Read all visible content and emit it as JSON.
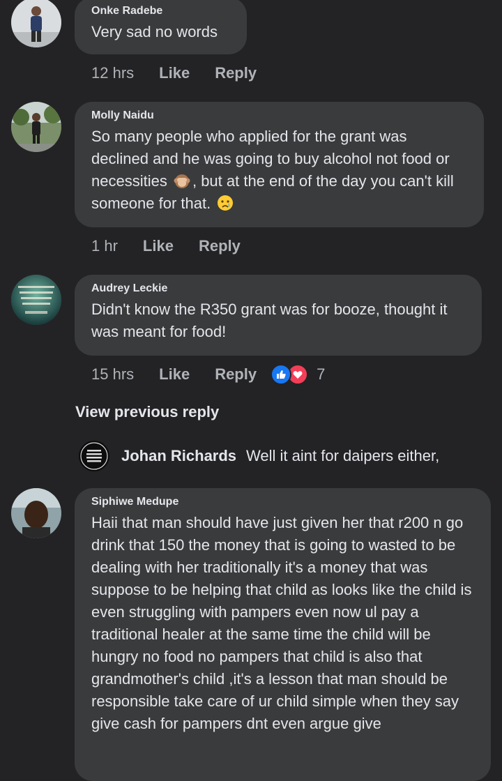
{
  "comments": [
    {
      "author": "Onke Radebe",
      "text": "Very sad no words",
      "time": "12 hrs",
      "like": "Like",
      "reply": "Reply"
    },
    {
      "author": "Molly Naidu",
      "text_a": "So many people who applied for the grant was declined and he was going to buy alcohol not food or necessities",
      "emoji_a": "see-no-evil-monkey",
      "text_b": ", but at the end of the day you can't kill someone for that.",
      "emoji_b": "crying-face",
      "time": "1 hr",
      "like": "Like",
      "reply": "Reply"
    },
    {
      "author": "Audrey Leckie",
      "text": "Didn't know the R350 grant was for booze, thought it was meant for food!",
      "time": "15 hrs",
      "like": "Like",
      "reply": "Reply",
      "reaction_count": "7",
      "reaction_icons": [
        "like-reaction",
        "love-reaction"
      ]
    },
    {
      "author": "Siphiwe Medupe",
      "text": "Haii that man should have just given her that r200 n go drink that 150 the money that is going to wasted to be dealing with her traditionally it's a money that was suppose to be helping that child as looks like the child is even struggling with pampers even now ul pay a traditional healer at the same time the child will be hungry no food no pampers that child is also that grandmother's child ,it's a lesson that man should be responsible take care of ur child simple when they say give cash for pampers dnt even argue give"
    }
  ],
  "view_previous": "View previous reply",
  "reply": {
    "author": "Johan Richards",
    "text": "Well it aint for daipers either,"
  },
  "colors": {
    "background": "#232325",
    "bubble": "#3a3b3c",
    "text": "#e4e6eb",
    "secondary": "#b0b3b8",
    "like_blue": "#1877f2",
    "love_red": "#f33e58"
  }
}
